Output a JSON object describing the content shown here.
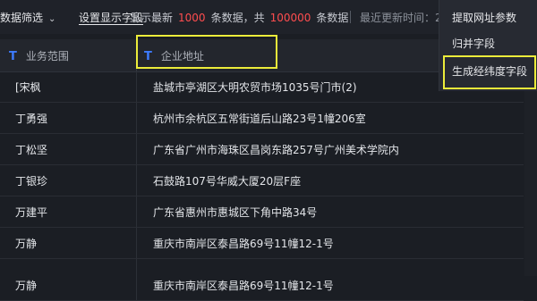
{
  "toolbar": {
    "filter_label": "数据筛选",
    "settings_label": "设置显示字段",
    "summary_prefix": "显示最新",
    "shown_count": "1000",
    "summary_mid": "条数据，共",
    "total_count": "100000",
    "summary_suffix": "条数据",
    "updated_label": "最近更新时间：2"
  },
  "columns": [
    {
      "type_icon": "T",
      "label": "业务范围"
    },
    {
      "type_icon": "T",
      "label": "企业地址"
    }
  ],
  "rows": [
    {
      "name": "[宋枫",
      "address": "盐城市亭湖区大明农贸市场1035号门市(2)"
    },
    {
      "name": "丁勇强",
      "address": "杭州市余杭区五常街道后山路23号1幢206室"
    },
    {
      "name": "丁松坚",
      "address": "广东省广州市海珠区昌岗东路257号广州美术学院内"
    },
    {
      "name": "丁银珍",
      "address": "石鼓路107号华威大厦20层F座"
    },
    {
      "name": "万建平",
      "address": "广东省惠州市惠城区下角中路34号"
    },
    {
      "name": "万静",
      "address": "重庆市南岸区泰昌路69号11幢12-1号"
    },
    {
      "name": "万静",
      "address": "重庆市南岸区泰昌路69号11幢12-1号"
    }
  ],
  "menu": {
    "items": [
      "提取网址参数",
      "归并字段",
      "生成经纬度字段"
    ]
  },
  "colors": {
    "highlight": "#ecec3a",
    "count_red": "#ff4d4f",
    "type_icon_blue": "#3d7bff"
  }
}
